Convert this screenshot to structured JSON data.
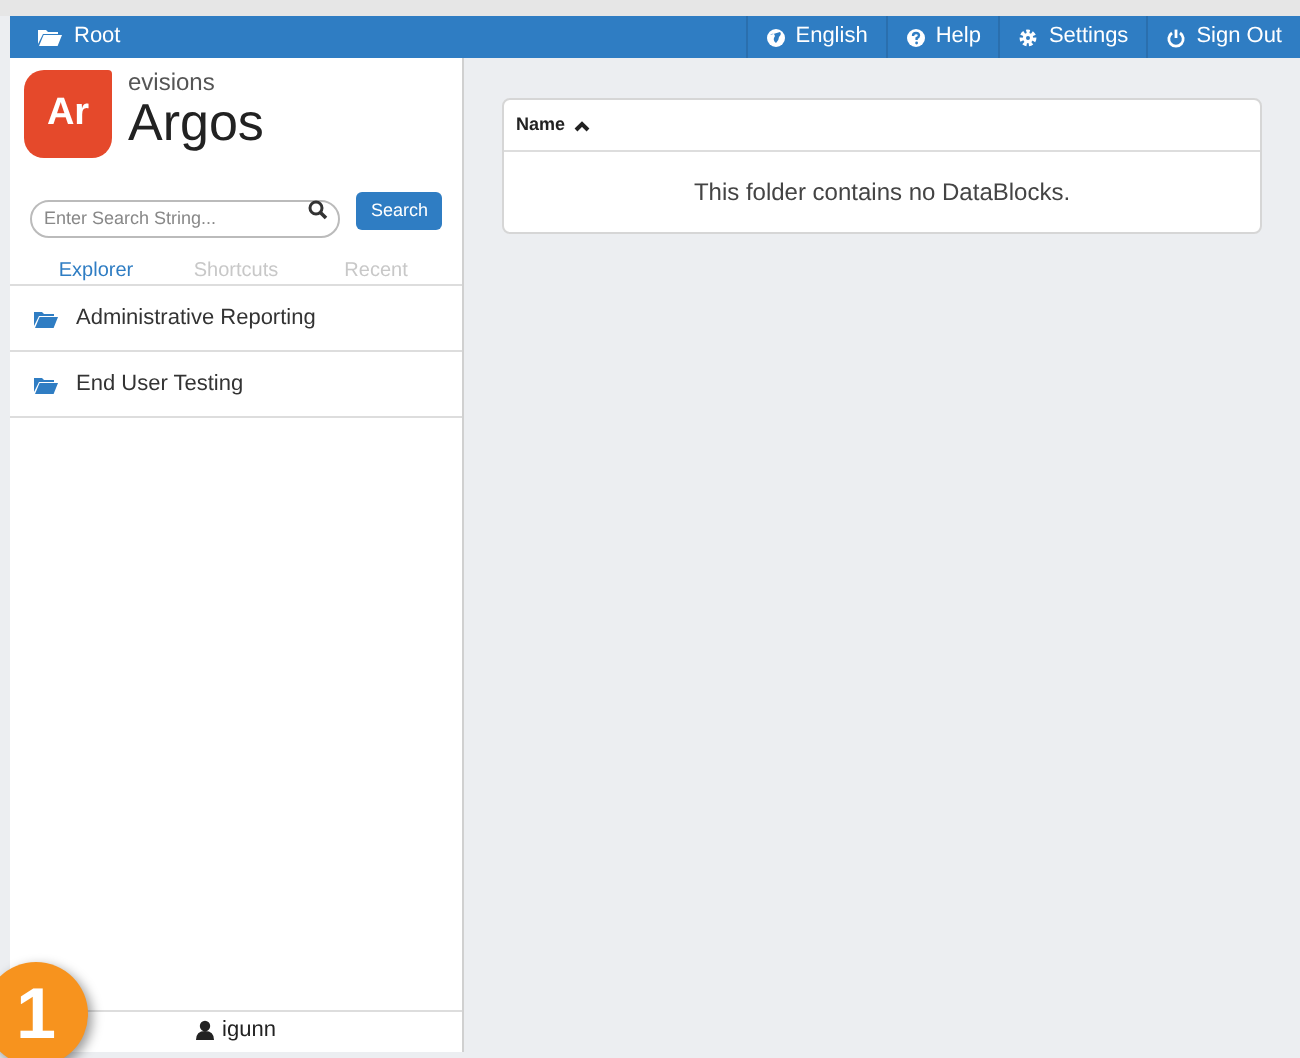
{
  "top_bar": {
    "breadcrumb": "Root",
    "menu": [
      {
        "kind": "globe",
        "label": "English"
      },
      {
        "kind": "help",
        "label": "Help"
      },
      {
        "kind": "gear",
        "label": "Settings"
      },
      {
        "kind": "power",
        "label": "Sign Out"
      }
    ]
  },
  "sidebar": {
    "logo": {
      "mark": "Ar",
      "company": "evisions",
      "product": "Argos"
    },
    "search": {
      "placeholder": "Enter Search String...",
      "button": "Search"
    },
    "tabs": [
      {
        "label": "Explorer",
        "selected": true
      },
      {
        "label": "Shortcuts",
        "selected": false
      },
      {
        "label": "Recent",
        "selected": false
      }
    ],
    "items": [
      {
        "label": "Administrative Reporting"
      },
      {
        "label": "End User Testing"
      }
    ],
    "user": "igunn"
  },
  "table": {
    "columns": [
      {
        "label": "Name",
        "sorted_ascending": true
      }
    ],
    "empty_message": "This folder contains no DataBlocks."
  },
  "step_badge": "1"
}
